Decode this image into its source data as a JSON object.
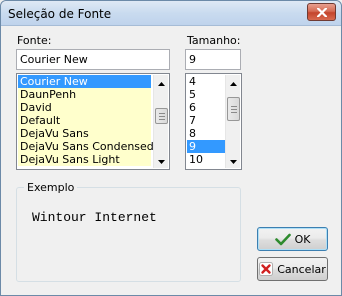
{
  "window": {
    "title": "Seleção de Fonte"
  },
  "font": {
    "label": "Fonte:",
    "value": "Courier New",
    "items": [
      "Courier New",
      "DaunPenh",
      "David",
      "Default",
      "DejaVu Sans",
      "DejaVu Sans Condensed",
      "DejaVu Sans Light"
    ],
    "selected": "Courier New"
  },
  "size": {
    "label": "Tamanho:",
    "value": "9",
    "items": [
      "4",
      "5",
      "6",
      "7",
      "8",
      "9",
      "10"
    ],
    "selected": "9"
  },
  "preview": {
    "label": "Exemplo",
    "sample_text": "Wintour Internet"
  },
  "buttons": {
    "ok": "OK",
    "cancel": "Cancelar"
  },
  "colors": {
    "selection": "#3399ff",
    "list_background": "#ffffcc",
    "ok_icon": "#2e8b2e",
    "cancel_icon": "#d02020"
  },
  "icons": {
    "close": "close-icon",
    "ok": "checkmark-icon",
    "cancel": "x-icon"
  }
}
